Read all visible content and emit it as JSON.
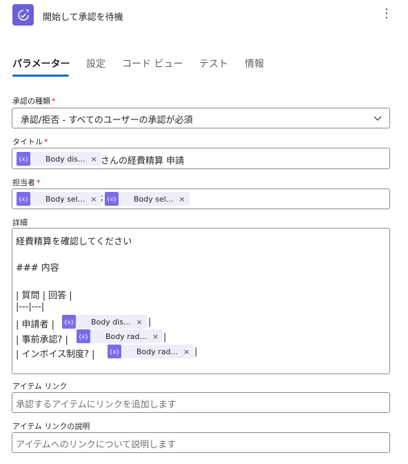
{
  "header": {
    "title": "開始して承認を待機",
    "more_glyph": "⋮"
  },
  "tabs": [
    {
      "label": "パラメーター",
      "active": true
    },
    {
      "label": "設定"
    },
    {
      "label": "コード ビュー"
    },
    {
      "label": "テスト"
    },
    {
      "label": "情報"
    }
  ],
  "approval_type": {
    "label": "承認の種類",
    "value": "承認/拒否 - すべてのユーザーの承認が必須"
  },
  "title_field": {
    "label": "タイトル",
    "token": "Body dis...",
    "suffix": "さんの経費精算 申請"
  },
  "assignees": {
    "label": "担当者",
    "token1": "Body sel...",
    "separator": ";",
    "token2": "Body sel..."
  },
  "details": {
    "label": "詳細",
    "line1": "経費精算を確認してください",
    "line2": "### 内容",
    "line3": "| 質問 | 回答 |",
    "line4": "|---|---|",
    "row1_prefix": "| 申請者 |",
    "row1_token": "Body dis...",
    "row2_prefix": "| 事前承認? |",
    "row2_token": "Body rad...",
    "row3_prefix": "| インボイス制度? |",
    "row3_token": "Body rad...",
    "row_suffix": "|"
  },
  "item_link": {
    "label": "アイテム リンク",
    "placeholder": "承認するアイテムにリンクを追加します"
  },
  "item_link_desc": {
    "label": "アイテム リンクの説明",
    "placeholder": "アイテムへのリンクについて説明します"
  },
  "token_icon_text": "{x}",
  "close_glyph": "×",
  "required_mark": "*",
  "colors": {
    "accent": "#0f6cbd",
    "token_icon": "#7a6ce8",
    "token_bg": "#eeedfa",
    "app_icon": "#6b5fd8"
  }
}
